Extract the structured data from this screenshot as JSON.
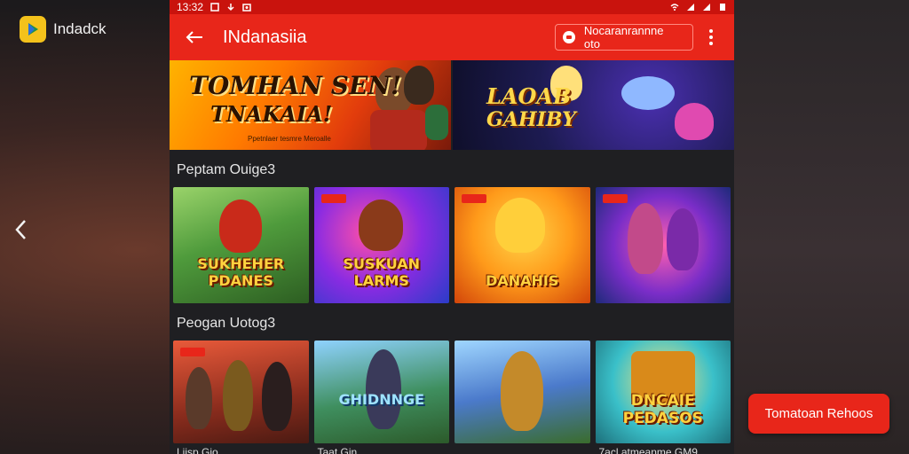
{
  "desktop": {
    "app_name": "Indadck",
    "left_nav_icon": "chevron-left-icon"
  },
  "statusbar": {
    "time": "13:32"
  },
  "appbar": {
    "title": "INdanasiia",
    "action_label": "Nocaranrannne oto"
  },
  "banners": [
    {
      "title": "TOMHAN SEN!",
      "subtitle": "TNAKAIA!",
      "caption": "Ppetnlaer tesmre Meroalle"
    },
    {
      "title": "LAOAB",
      "subtitle": "GAHIBY"
    }
  ],
  "sections": [
    {
      "title": "Peptam Ouige3",
      "cards": [
        {
          "label": "SUKHEHER PDANES"
        },
        {
          "label": "SUSKUAN LARMS"
        },
        {
          "label": "DANAHIS"
        },
        {
          "label": ""
        }
      ]
    },
    {
      "title": "Peogan Uotog3",
      "cards": [
        {
          "label": "",
          "caption": "Liisp Gio"
        },
        {
          "label": "GHIDNNGE",
          "caption": "Taat Gin"
        },
        {
          "label": "",
          "caption": ""
        },
        {
          "label": "DNCAIE PEDASOS",
          "caption": "7acl atmeanme GM9"
        }
      ]
    }
  ],
  "fab": {
    "label": "Tomatoan Rehoos"
  },
  "colors": {
    "brand_red": "#e8261a",
    "statusbar_red": "#c9130d",
    "logo_yellow": "#f4c21b"
  }
}
